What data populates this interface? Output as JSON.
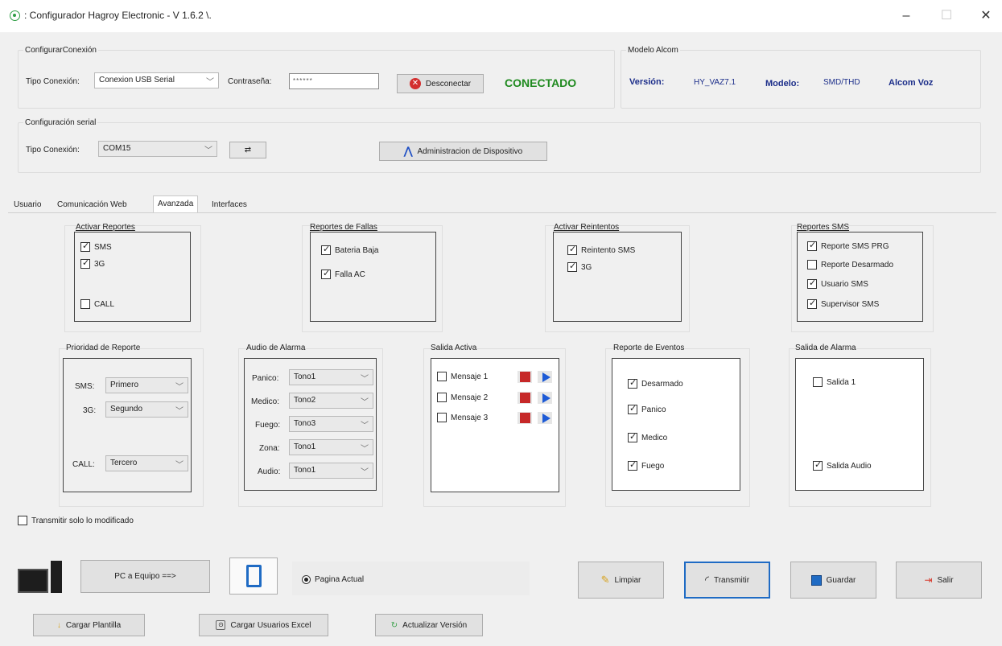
{
  "window": {
    "title": ": Configurador Hagroy Electronic - V 1.6.2 \\.",
    "minimize": "–",
    "maximize": "☐",
    "close": "✕"
  },
  "connection": {
    "group_label": "ConfigurarConexión",
    "type_label": "Tipo Conexión:",
    "type_value": "Conexion USB Serial",
    "password_label": "Contraseña:",
    "password_value": "******",
    "disconnect_label": "Desconectar",
    "status": "CONECTADO"
  },
  "model": {
    "group_label": "Modelo Alcom",
    "version_label": "Versión:",
    "version_value": "HY_VAZ7.1",
    "model_label": "Modelo:",
    "model_value": "SMD/THD",
    "product": "Alcom Voz"
  },
  "serial": {
    "group_label": "Configuración serial",
    "type_label": "Tipo Conexión:",
    "port_value": "COM15",
    "refresh_glyph": "⇄",
    "admin_label": "Administracion de Dispositivo"
  },
  "tabs": [
    "Usuario",
    "Comunicación Web",
    "Avanzada",
    "Interfaces"
  ],
  "active_tab": "Avanzada",
  "reportes": {
    "title": "Activar Reportes",
    "items": [
      {
        "label": "SMS",
        "checked": true
      },
      {
        "label": "3G",
        "checked": true
      },
      {
        "label": "CALL",
        "checked": false
      }
    ]
  },
  "fallas": {
    "title": "Reportes de Fallas",
    "items": [
      {
        "label": "Bateria Baja",
        "checked": true
      },
      {
        "label": "Falla AC",
        "checked": true
      }
    ]
  },
  "reintentos": {
    "title": "Activar Reintentos",
    "items": [
      {
        "label": "Reintento SMS",
        "checked": true
      },
      {
        "label": "3G",
        "checked": true
      }
    ]
  },
  "sms": {
    "title": "Reportes SMS",
    "items": [
      {
        "label": "Reporte SMS PRG",
        "checked": true
      },
      {
        "label": "Reporte Desarmado",
        "checked": false
      },
      {
        "label": "Usuario SMS",
        "checked": true
      },
      {
        "label": "Supervisor SMS",
        "checked": true
      }
    ]
  },
  "prioridad": {
    "title": "Prioridad de Reporte",
    "rows": [
      {
        "label": "SMS:",
        "value": "Primero"
      },
      {
        "label": "3G:",
        "value": "Segundo"
      },
      {
        "label": "CALL:",
        "value": "Tercero"
      }
    ]
  },
  "audio": {
    "title": "Audio de Alarma",
    "rows": [
      {
        "label": "Panico:",
        "value": "Tono1"
      },
      {
        "label": "Medico:",
        "value": "Tono2"
      },
      {
        "label": "Fuego:",
        "value": "Tono3"
      },
      {
        "label": "Zona:",
        "value": "Tono1"
      },
      {
        "label": "Audio:",
        "value": "Tono1"
      }
    ]
  },
  "salida_activa": {
    "title": "Salida Activa",
    "items": [
      {
        "label": "Mensaje 1",
        "checked": false
      },
      {
        "label": "Mensaje 2",
        "checked": false
      },
      {
        "label": "Mensaje 3",
        "checked": false
      }
    ]
  },
  "eventos": {
    "title": "Reporte de Eventos",
    "items": [
      {
        "label": "Desarmado",
        "checked": true
      },
      {
        "label": "Panico",
        "checked": true
      },
      {
        "label": "Medico",
        "checked": true
      },
      {
        "label": "Fuego",
        "checked": true
      }
    ]
  },
  "salida_alarma": {
    "title": "Salida de Alarma",
    "items": [
      {
        "label": "Salida 1",
        "checked": false
      },
      {
        "label": "Salida Audio",
        "checked": true
      }
    ]
  },
  "transmit_modified": {
    "label": "Transmitir solo lo modificado",
    "checked": false
  },
  "bottom": {
    "pc_to_device": "PC a Equipo ==>",
    "current_page": "Pagina Actual",
    "clear": "Limpiar",
    "transmit": "Transmitir",
    "save": "Guardar",
    "exit": "Salir",
    "load_template": "Cargar Plantilla",
    "load_users": "Cargar Usuarios Excel",
    "update_version": "Actualizar Versión"
  }
}
